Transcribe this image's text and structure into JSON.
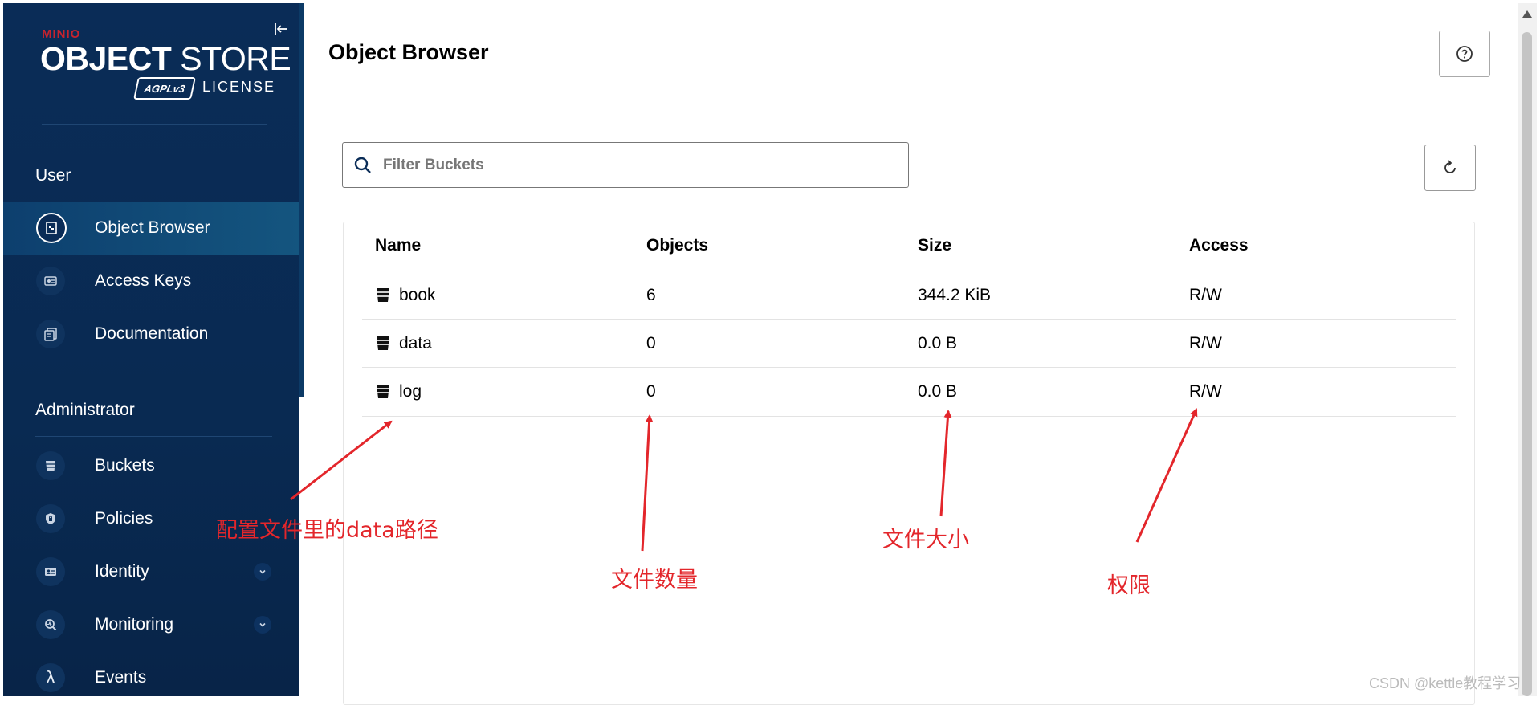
{
  "app": {
    "logo_brand": "MINIO",
    "logo_title_bold": "OBJECT",
    "logo_title_rest": "STORE",
    "logo_badge": "AGPLv3",
    "logo_license": "LICENSE"
  },
  "sidebar": {
    "section_user": "User",
    "section_admin": "Administrator",
    "user_items": [
      {
        "label": "Object Browser",
        "icon": "object-browser-icon",
        "active": true
      },
      {
        "label": "Access Keys",
        "icon": "access-keys-icon"
      },
      {
        "label": "Documentation",
        "icon": "documentation-icon"
      }
    ],
    "admin_items": [
      {
        "label": "Buckets",
        "icon": "bucket-icon"
      },
      {
        "label": "Policies",
        "icon": "policy-shield-icon"
      },
      {
        "label": "Identity",
        "icon": "identity-card-icon",
        "expandable": true
      },
      {
        "label": "Monitoring",
        "icon": "monitoring-icon",
        "expandable": true
      },
      {
        "label": "Events",
        "icon": "lambda-icon"
      }
    ]
  },
  "header": {
    "title": "Object Browser"
  },
  "search": {
    "placeholder": "Filter Buckets"
  },
  "table": {
    "headers": [
      "Name",
      "Objects",
      "Size",
      "Access"
    ],
    "rows": [
      {
        "name": "book",
        "objects": "6",
        "size": "344.2 KiB",
        "access": "R/W"
      },
      {
        "name": "data",
        "objects": "0",
        "size": "0.0 B",
        "access": "R/W"
      },
      {
        "name": "log",
        "objects": "0",
        "size": "0.0 B",
        "access": "R/W"
      }
    ]
  },
  "annotations": {
    "path": "配置文件里的data路径",
    "count": "文件数量",
    "size": "文件大小",
    "access": "权限",
    "color": "#e3262b"
  },
  "watermark": "CSDN @kettle教程学习",
  "colors": {
    "sidebar_bg": "#0a2c57",
    "active_item": "#14557f",
    "brand_red": "#c7232e"
  }
}
